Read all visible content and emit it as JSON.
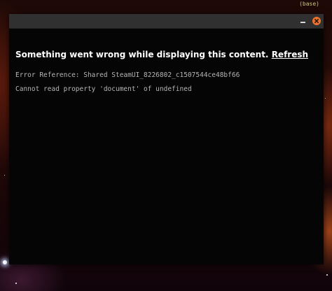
{
  "desktop": {
    "env_indicator": "(base)"
  },
  "window": {
    "titlebar": {
      "minimize_icon": "minimize-icon",
      "close_icon": "close-icon",
      "close_color": "#e8732e"
    },
    "error": {
      "title": "Something went wrong while displaying this content.",
      "refresh_label": "Refresh",
      "reference": "Error Reference: Shared SteamUI_8226802_c1507544ce48bf66",
      "message": "Cannot read property 'document' of undefined"
    }
  },
  "colors": {
    "window_background": "#050505",
    "titlebar_background": "#303030",
    "text_primary": "#ffffff",
    "text_mono": "#b5b5b5"
  }
}
